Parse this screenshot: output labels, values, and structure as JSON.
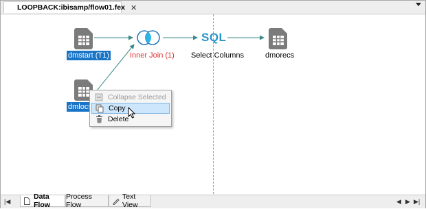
{
  "tabs": {
    "document_title": "LOOPBACK:ibisamp/flow01.fex",
    "close_glyph": "✕"
  },
  "nodes": {
    "source1_label": "dmstart (T1)",
    "source2_label": "dmlocs",
    "join_label": "Inner Join (1)",
    "sql_text": "SQL",
    "select_label": "Select Columns",
    "target_label": "dmorecs"
  },
  "context_menu": {
    "items": [
      {
        "label": "Collapse Selected",
        "icon": "collapse-icon",
        "enabled": false
      },
      {
        "label": "Copy",
        "icon": "copy-icon",
        "enabled": true
      },
      {
        "label": "Delete",
        "icon": "delete-icon",
        "enabled": true
      }
    ]
  },
  "bottom_tabs": {
    "items": [
      {
        "label": "Data Flow",
        "icon": "data-flow-icon",
        "active": true
      },
      {
        "label": "Process Flow",
        "icon": "",
        "active": false
      },
      {
        "label": "Text View",
        "icon": "text-view-icon",
        "active": false
      }
    ]
  },
  "colors": {
    "selection": "#1a74c6",
    "join_label": "#e03030",
    "sql_icon": "#2a93c9",
    "connector": "#3b8a8a"
  }
}
